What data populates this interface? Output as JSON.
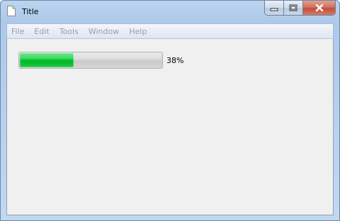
{
  "window": {
    "title": "Title",
    "icon": "document-icon"
  },
  "caption_buttons": {
    "minimize_icon": "minimize-icon",
    "maximize_icon": "maximize-icon",
    "close_icon": "close-icon"
  },
  "menu": {
    "items": [
      {
        "label": "File"
      },
      {
        "label": "Edit"
      },
      {
        "label": "Tools"
      },
      {
        "label": "Window"
      },
      {
        "label": "Help"
      }
    ]
  },
  "progress": {
    "value": 0.38,
    "label": "38%"
  },
  "colors": {
    "progress_fill": "#16cc3e",
    "close_button": "#c2503a",
    "titlebar": "#bcd4ef"
  }
}
